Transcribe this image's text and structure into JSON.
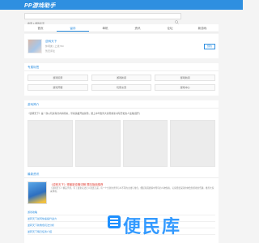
{
  "header": {
    "logo": "PP游戏助手",
    "search_placeholder": "搜索入游戏名字"
  },
  "nav": {
    "tabs": [
      "首页",
      "留存",
      "单机",
      "资讯",
      "论坛",
      "新游戏"
    ],
    "active_index": 1
  },
  "profile": {
    "name": "逆转天下",
    "meta": "休闲类 | 上线 5M",
    "status": "暂无评论",
    "reserve_label": "预约"
  },
  "tags": {
    "title": "专属标签",
    "items": [
      "游戏玩家",
      "游戏新闻",
      "游戏新闻",
      "游戏开服",
      "玩家交流",
      "游戏中心"
    ]
  },
  "intro": {
    "title": "游戏简介",
    "text": "《逆转天下》是一款以玩家得分内得闯关，带着英雄开启冒险，踏上中华世界大冒险重新书写历史的人生路[展开]",
    "more": "[展开]"
  },
  "news": {
    "title": "最新资讯",
    "feature_title": "《逆转天下》得最新攻略详解 冒险指南推荐",
    "feature_summary": "《逆转天下》精美手游，带了最新玩法让人流连忘返，有一个全新的世界与众不同的主线与角色，细腻刻画剧情中所有的人物性格，玩家能更深刻的体会到游戏的乐趣，推荐大家来体验。",
    "items": [
      "游戏攻略",
      "逆转天下如何快速提升战力",
      "逆转天下新角色玩法分析",
      "逆转天下每日任务介绍"
    ]
  },
  "watermark": {
    "text": "便民库",
    "color": "#1e90ff"
  },
  "colors": {
    "accent": "#2e8fe0",
    "headline": "#e0443a"
  }
}
